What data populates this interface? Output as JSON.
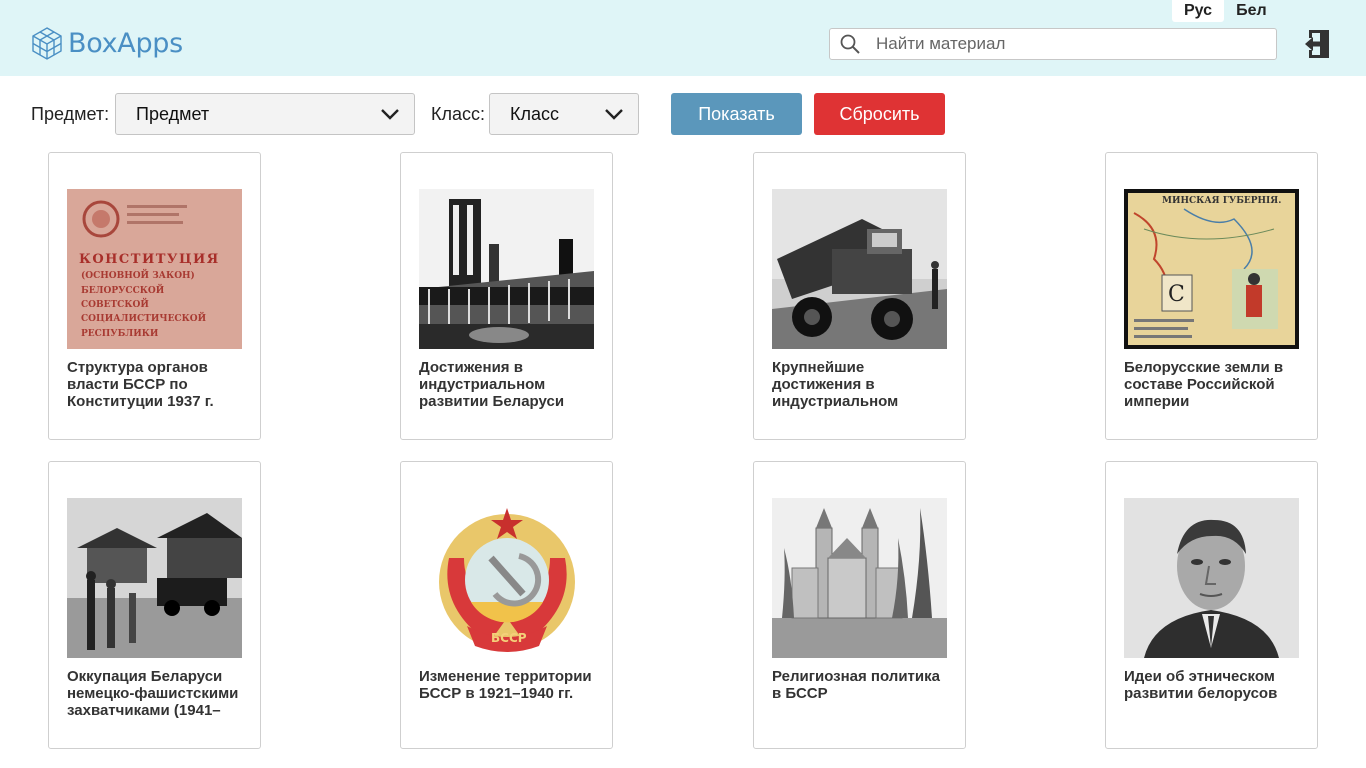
{
  "header": {
    "logo_text": "BoxApps",
    "languages": [
      {
        "label": "Рус",
        "active": true
      },
      {
        "label": "Бел",
        "active": false
      }
    ],
    "search_placeholder": "Найти материал",
    "logout_icon": "logout-door-icon"
  },
  "filters": {
    "subject_label": "Предмет:",
    "subject_value": "Предмет",
    "grade_label": "Класс:",
    "grade_value": "Класс",
    "show_button": "Показать",
    "reset_button": "Сбросить"
  },
  "cards": [
    {
      "title": "Структура органов власти БССР по Конституции 1937 г.",
      "image": "constitution-cover-image"
    },
    {
      "title": "Достижения в индустриальном развитии Беларуси",
      "image": "industrial-plant-photo"
    },
    {
      "title": "Крупнейшие достижения в индустриальном",
      "image": "dump-truck-photo"
    },
    {
      "title": "Белорусские земли в составе Российской империи",
      "image": "minsk-governorate-map"
    },
    {
      "title": "Оккупация Беларуси немецко-фашистскими захватчиками (1941–",
      "image": "occupation-village-photo"
    },
    {
      "title": "Изменение территории БССР в 1921–1940 гг.",
      "image": "bssr-coat-of-arms"
    },
    {
      "title": "Религиозная политика в БССР",
      "image": "church-drawing"
    },
    {
      "title": "Идеи об этническом развитии белорусов",
      "image": "portrait-photo"
    }
  ],
  "colors": {
    "header_bg": "#dff5f7",
    "logo": "#4a8fc4",
    "show_button": "#5b97bb",
    "reset_button": "#df3334"
  }
}
